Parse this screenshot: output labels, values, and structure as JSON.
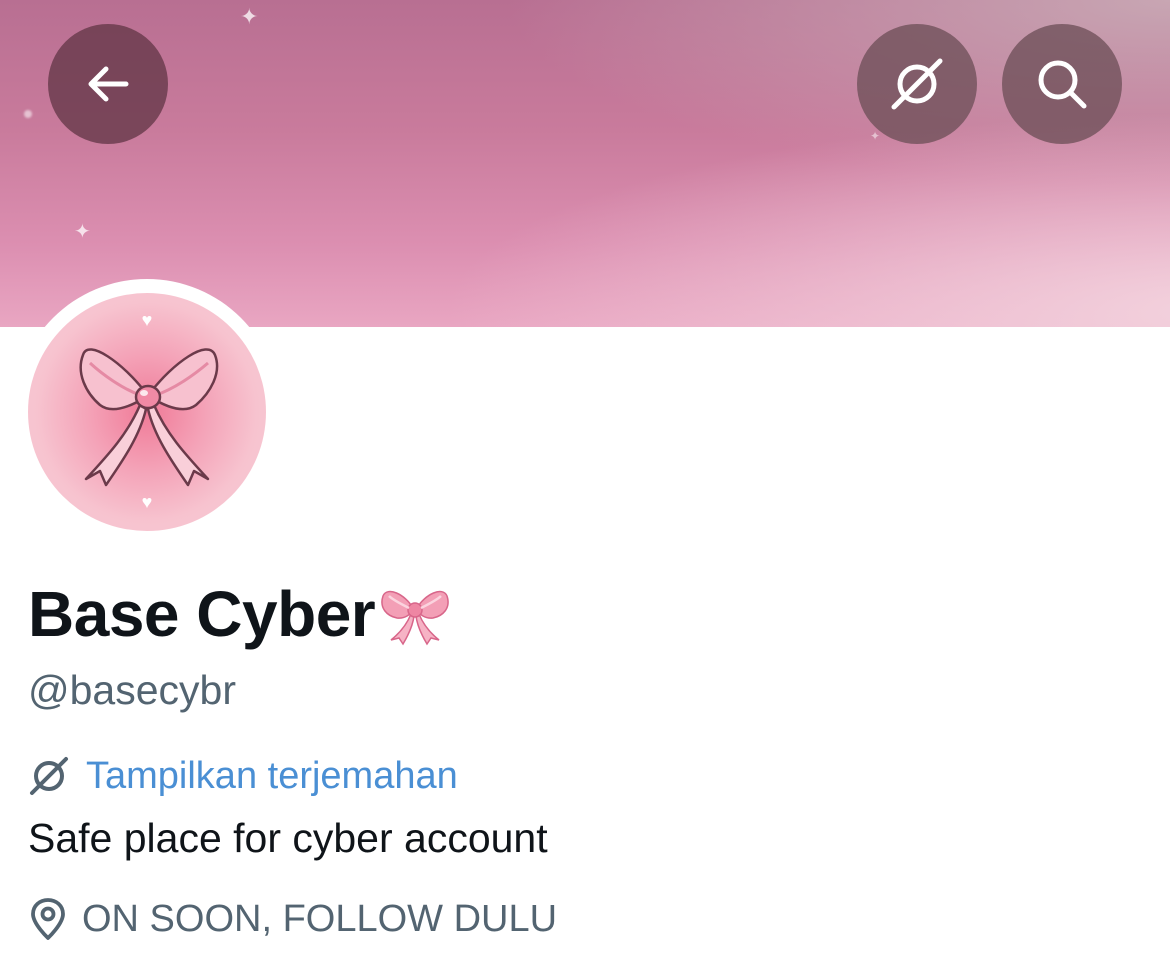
{
  "header": {
    "back_icon": "arrow-left-icon",
    "translate_icon": "translate-globe-icon",
    "search_icon": "search-icon"
  },
  "profile": {
    "display_name": "Base Cyber",
    "name_emoji": "ribbon-bow-emoji",
    "handle": "@basecybr",
    "translate_label": "Tampilkan terjemahan",
    "bio": "Safe place for cyber account",
    "location": "ON SOON, FOLLOW DULU"
  },
  "colors": {
    "banner_pink": "#c97b9c",
    "link_blue": "#4a8fd4",
    "text_primary": "#0f1419",
    "text_secondary": "#536471",
    "avatar_pink": "#f4a3b8"
  }
}
